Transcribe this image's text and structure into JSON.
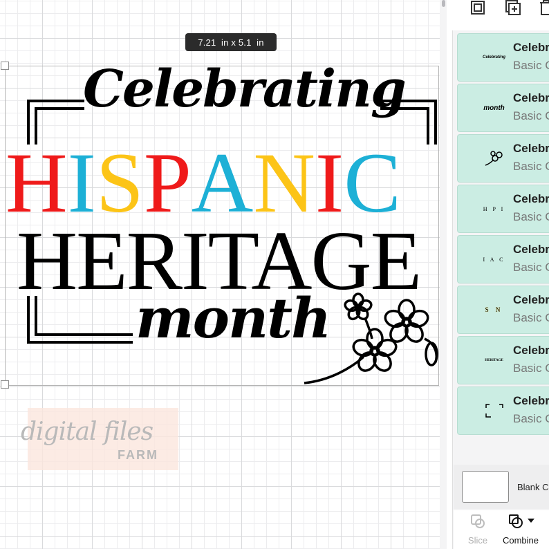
{
  "canvas": {
    "size_tooltip": "7.21  in x 5.1  in"
  },
  "design": {
    "line1": "Celebrating",
    "line2_letters": [
      {
        "ch": "H",
        "color": "#ef1a1a"
      },
      {
        "ch": "I",
        "color": "#1db0d6"
      },
      {
        "ch": "S",
        "color": "#fcc417"
      },
      {
        "ch": "P",
        "color": "#ef1a1a"
      },
      {
        "ch": "A",
        "color": "#1db0d6"
      },
      {
        "ch": "N",
        "color": "#fcc417"
      },
      {
        "ch": "I",
        "color": "#ef1a1a"
      },
      {
        "ch": "C",
        "color": "#1db0d6"
      }
    ],
    "line3": "HERITAGE",
    "line4": "month",
    "decoration": "flower-sprig-icon"
  },
  "watermark": {
    "line1": "digital files",
    "line2": "FARM"
  },
  "panel": {
    "top_icons": [
      "group-icon",
      "duplicate-icon",
      "delete-icon"
    ],
    "layers": [
      {
        "name": "Celebr",
        "sub": "Basic C",
        "thumb": "Celebrating"
      },
      {
        "name": "Celebr",
        "sub": "Basic C",
        "thumb": "month"
      },
      {
        "name": "Celebr",
        "sub": "Basic C",
        "thumb": "flower"
      },
      {
        "name": "Celebr",
        "sub": "Basic C",
        "thumb": "H P I"
      },
      {
        "name": "Celebr",
        "sub": "Basic C",
        "thumb": "I A C"
      },
      {
        "name": "Celebr",
        "sub": "Basic C",
        "thumb": "S N"
      },
      {
        "name": "Celebr",
        "sub": "Basic C",
        "thumb": "HERITAGE"
      },
      {
        "name": "Celebr",
        "sub": "Basic C",
        "thumb": "frame"
      }
    ],
    "blank_canvas_label": "Blank Ca",
    "tools": {
      "slice": "Slice",
      "combine": "Combine"
    }
  },
  "colors": {
    "accent_layer_bg": "#cbede3",
    "red": "#ef1a1a",
    "blue": "#1db0d6",
    "yellow": "#fcc417"
  }
}
